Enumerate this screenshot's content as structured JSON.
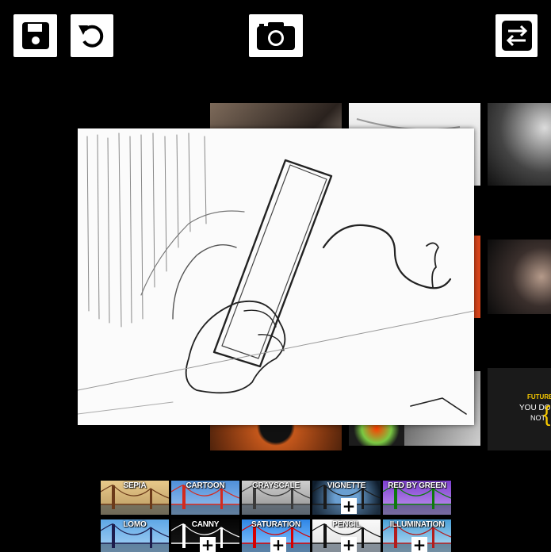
{
  "toolbar": {
    "save": "save-icon",
    "reset": "rotate-ccw-icon",
    "capture": "camera-icon",
    "swap": "swap-icon"
  },
  "effects": [
    {
      "label": "SEPIA",
      "plus": false
    },
    {
      "label": "CARTOON",
      "plus": false
    },
    {
      "label": "GRAYSCALE",
      "plus": false
    },
    {
      "label": "VIGNETTE",
      "plus": true
    },
    {
      "label": "RED BY GREEN",
      "plus": false
    },
    {
      "label": "LOMO",
      "plus": false
    },
    {
      "label": "CANNY",
      "plus": true
    },
    {
      "label": "SATURATION",
      "plus": true
    },
    {
      "label": "PENCIL",
      "plus": true
    },
    {
      "label": "ILLUMINATION",
      "plus": true
    }
  ],
  "gallery_poster": {
    "line1": "FUTURE",
    "line2": "YOU DO",
    "line3": "NOT"
  },
  "plus_symbol": "+",
  "colors": {
    "background": "#000000",
    "button": "#ffffff",
    "icon": "#000000"
  }
}
